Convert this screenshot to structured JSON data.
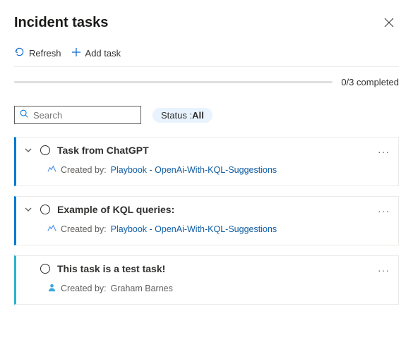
{
  "header": {
    "title": "Incident tasks"
  },
  "toolbar": {
    "refresh_label": "Refresh",
    "add_task_label": "Add task"
  },
  "progress": {
    "label": "0/3 completed"
  },
  "search": {
    "placeholder": "Search"
  },
  "status_filter": {
    "prefix": "Status : ",
    "value": "All"
  },
  "tasks": [
    {
      "title": "Task from ChatGPT",
      "created_prefix": "Created by: ",
      "created_link": "Playbook - OpenAi-With-KQL-Suggestions",
      "source": "playbook",
      "expandable": true
    },
    {
      "title": "Example of KQL queries:",
      "created_prefix": "Created by: ",
      "created_link": "Playbook - OpenAi-With-KQL-Suggestions",
      "source": "playbook",
      "expandable": true
    },
    {
      "title": "This task is a test task!",
      "created_prefix": "Created by: ",
      "created_text": "Graham Barnes",
      "source": "user",
      "expandable": false
    }
  ]
}
